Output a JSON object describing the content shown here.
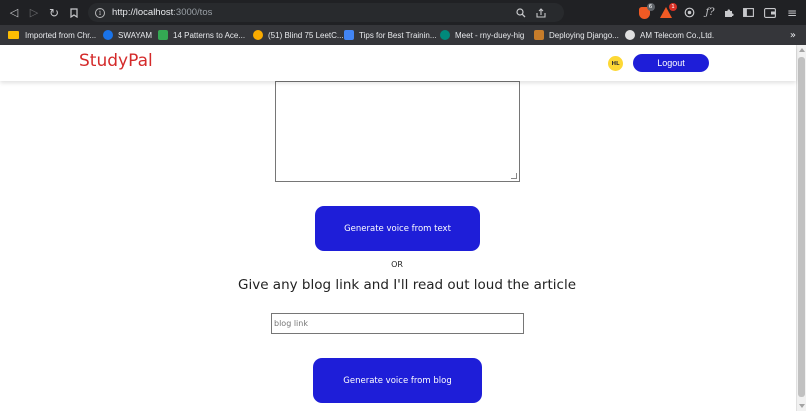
{
  "browser": {
    "url_host": "http://localhost",
    "url_path": ":3000/tos",
    "extension_badge_1": "6",
    "extension_badge_2": "1"
  },
  "bookmarks": [
    {
      "label": "Imported from Chr...",
      "icon": "folder-icon"
    },
    {
      "label": "SWAYAM",
      "icon": "swayam-icon"
    },
    {
      "label": "14 Patterns to Ace...",
      "icon": "patterns-icon"
    },
    {
      "label": "(51) Blind 75 LeetC...",
      "icon": "leetcode-icon"
    },
    {
      "label": "Tips for Best Trainin...",
      "icon": "tips-icon"
    },
    {
      "label": "Meet - rny-duey-hig",
      "icon": "meet-icon"
    },
    {
      "label": "Deploying Django...",
      "icon": "django-icon"
    },
    {
      "label": "AM Telecom Co.,Ltd.",
      "icon": "telecom-icon"
    }
  ],
  "app": {
    "logo": "StudyPal",
    "avatar_initials": "HL",
    "logout_label": "Logout"
  },
  "main": {
    "generate_text_label": "Generate voice from text",
    "or_label": "OR",
    "blog_heading": "Give any blog link and I'll read out loud the article",
    "blog_placeholder": "blog link",
    "generate_blog_label": "Generate voice from blog"
  },
  "colors": {
    "accent": "#1e1ed8",
    "logo": "#d42a2a",
    "avatar": "#fdd835"
  }
}
